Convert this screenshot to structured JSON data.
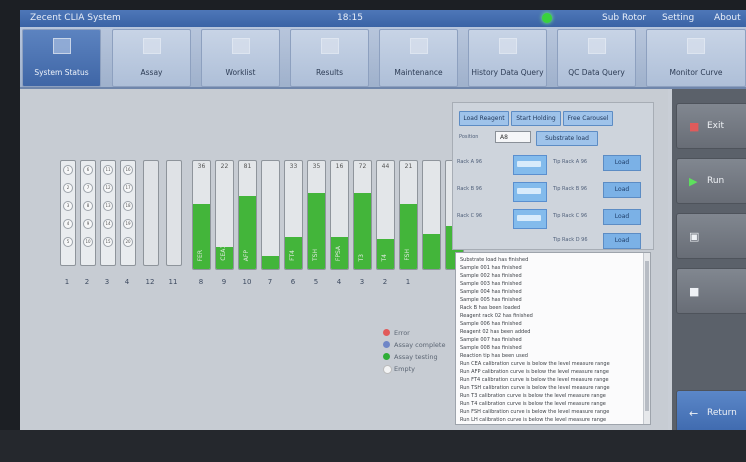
{
  "title": {
    "app": "Zecent CLIA System",
    "time": "18:15",
    "submit": "Sub Rotor",
    "setting": "Setting",
    "about": "About"
  },
  "tabs": [
    {
      "label": "System Status"
    },
    {
      "label": "Assay"
    },
    {
      "label": "Worklist"
    },
    {
      "label": "Results"
    },
    {
      "label": "Maintenance"
    },
    {
      "label": "History Data Query"
    },
    {
      "label": "QC Data Query"
    },
    {
      "label": "Monitor Curve"
    }
  ],
  "right_buttons": {
    "exit": "Exit",
    "run": "Run",
    "return": "Return"
  },
  "control": {
    "buttons": [
      "Load Reagent",
      "Start Holding",
      "Free Carousel"
    ],
    "position_label": "Position",
    "position_value": "A8",
    "substrate_label": "Substrate load",
    "rows": [
      {
        "left": "Rack A 96",
        "right": "Tip Rack A 96",
        "button": "Load"
      },
      {
        "left": "Rack B 96",
        "right": "Tip Rack B 96",
        "button": "Load"
      },
      {
        "left": "Rack C 96",
        "right": "Tip Rack C 96",
        "button": "Load"
      },
      {
        "left": "",
        "right": "Tip Rack D 96",
        "button": "Load"
      }
    ]
  },
  "racks": {
    "labels": [
      "1",
      "2",
      "3",
      "4",
      "12",
      "11",
      "8",
      "9",
      "10",
      "7",
      "6",
      "5",
      "4",
      "3",
      "2",
      "1"
    ],
    "fill_percent": [
      60,
      20,
      68,
      12,
      30,
      70,
      30,
      70,
      28,
      60,
      32,
      40
    ],
    "rack_numbers": [
      "36",
      "22",
      "81",
      "",
      "33",
      "35",
      "16",
      "72",
      "44",
      "21",
      "",
      ""
    ],
    "rack_texts": [
      "FER",
      "CEA15",
      "AFP",
      "",
      "FT4",
      "TSH",
      "FPSA",
      "T3",
      "T4",
      "FSH",
      "",
      ""
    ]
  },
  "legend": [
    {
      "label": "Error",
      "color": "#e15a5a"
    },
    {
      "label": "Assay complete",
      "color": "#6f86c7"
    },
    {
      "label": "Assay testing",
      "color": "#2fae37"
    },
    {
      "label": "Empty",
      "color": "#f3f4f5"
    }
  ],
  "log": [
    "Substrate load has finished",
    "Sample 001 has finished",
    "Sample 002 has finished",
    "Sample 003 has finished",
    "Sample 004 has finished",
    "Sample 005 has finished",
    "Rack B has been loaded",
    "Reagent rack 02 has finished",
    "Sample 006 has finished",
    "Reagent 02 has been added",
    "Sample 007 has finished",
    "Sample 008 has finished",
    "Reaction tip has been used",
    "Run CEA calibration curve is below the level measure range",
    "Run AFP calibration curve is below the level measure range",
    "Run FT4 calibration curve is below the level measure range",
    "Run TSH calibration curve is below the level measure range",
    "Run T3 calibration curve is below the level measure range",
    "Run T4 calibration curve is below the level measure range",
    "Run FSH calibration curve is below the level measure range",
    "Run LH calibration curve is below the level measure range"
  ]
}
